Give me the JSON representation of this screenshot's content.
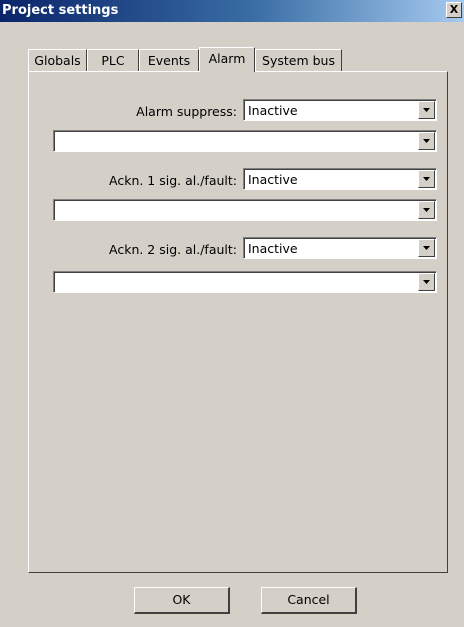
{
  "window": {
    "title": "Project settings",
    "close_label": "X"
  },
  "tabs": [
    {
      "label": "Globals"
    },
    {
      "label": "PLC"
    },
    {
      "label": "Events"
    },
    {
      "label": "Alarm",
      "active": true
    },
    {
      "label": "System bus"
    }
  ],
  "alarm": {
    "alarm_suppress": {
      "label": "Alarm suppress:",
      "value": "Inactive",
      "expression": ""
    },
    "ackn_1": {
      "label": "Ackn. 1 sig. al./fault:",
      "value": "Inactive",
      "expression": ""
    },
    "ackn_2": {
      "label": "Ackn. 2 sig. al./fault:",
      "value": "Inactive",
      "expression": ""
    }
  },
  "buttons": {
    "ok": "OK",
    "cancel": "Cancel"
  }
}
